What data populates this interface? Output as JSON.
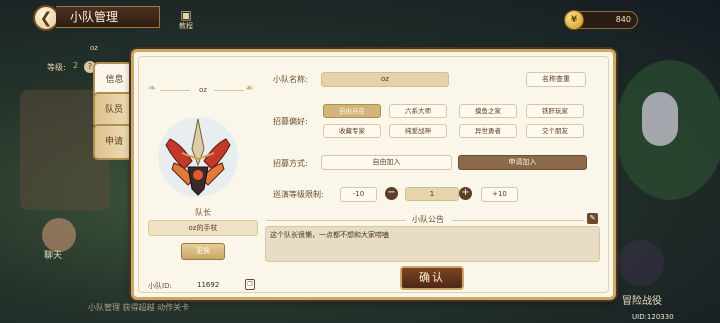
{
  "topbar": {
    "title": "小队管理",
    "tutorial_label": "教程",
    "currency_value": "840"
  },
  "side_widget": {
    "team_name": "oz",
    "level_label": "等级:",
    "level_value": "2",
    "help_symbol": "?"
  },
  "tabs": [
    {
      "label": "信息",
      "active": true
    },
    {
      "label": "队员",
      "active": false
    },
    {
      "label": "申请",
      "active": false
    }
  ],
  "team": {
    "name": "oz",
    "leader_caption": "队长",
    "leader_name": "oz的手杖",
    "change_button": "更换",
    "id_label": "小队ID:",
    "id_value": "11692"
  },
  "form": {
    "name_label": "小队名称:",
    "name_value": "oz",
    "name_check_button": "名称查重",
    "preference_label": "招募偏好:",
    "preferences": [
      {
        "label": "自由自在",
        "selected": true
      },
      {
        "label": "六系大师",
        "selected": false
      },
      {
        "label": "摸鱼之家",
        "selected": false
      },
      {
        "label": "铁肝玩家",
        "selected": false
      },
      {
        "label": "收藏专家",
        "selected": false
      },
      {
        "label": "纯爱战神",
        "selected": false
      },
      {
        "label": "异世勇者",
        "selected": false
      },
      {
        "label": "交个朋友",
        "selected": false
      }
    ],
    "method_label": "招募方式:",
    "method_free": "自由加入",
    "method_apply": "申请加入",
    "level_limit_label": "巡演等级限制:",
    "minus_ten": "-10",
    "minus": "−",
    "level_value": "1",
    "plus": "+",
    "plus_ten": "+10"
  },
  "notice": {
    "title": "小队公告",
    "content": "这个队长很懒，一点都不想和大家唠嗑"
  },
  "confirm_button": "确认",
  "background": {
    "chat_label": "聊天",
    "bottom_text": "小队管理  获得超越  动作关卡",
    "adventure_label": "冒险战役",
    "uid": "UID:120330"
  },
  "colors": {
    "selected_chip": "#d3b47a",
    "confirm": "#6a3a20",
    "frame": "#c9a86a"
  }
}
